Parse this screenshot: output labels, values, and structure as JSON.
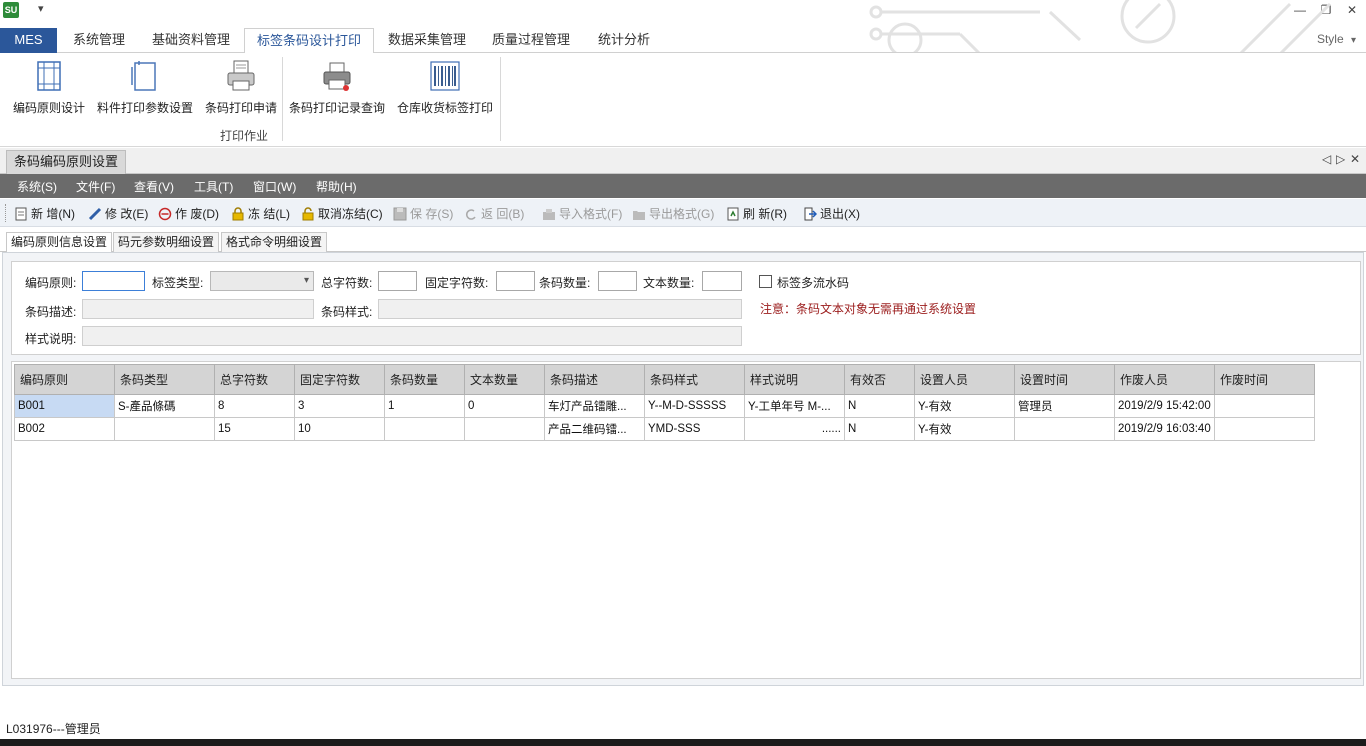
{
  "app": {
    "logo_text": "SU",
    "quick_access": "▾",
    "window_controls": [
      "—",
      "❐",
      "✕"
    ]
  },
  "ribbon": {
    "tabs": [
      {
        "label": "MES"
      },
      {
        "label": "系统管理"
      },
      {
        "label": "基础资料管理"
      },
      {
        "label": "标签条码设计打印"
      },
      {
        "label": "数据采集管理"
      },
      {
        "label": "质量过程管理"
      },
      {
        "label": "统计分析"
      }
    ],
    "active_tab": "标签条码设计打印",
    "style_label": "Style",
    "style_arrow": "▾",
    "buttons": [
      {
        "label": "编码原则设计",
        "icon": "frame-icon"
      },
      {
        "label": "料件打印参数设置",
        "icon": "document-settings-icon"
      },
      {
        "label": "条码打印申请",
        "icon": "printer-document-icon"
      },
      {
        "label": "条码打印记录查询",
        "icon": "printer-icon"
      },
      {
        "label": "仓库收货标签打印",
        "icon": "barcode-icon"
      }
    ],
    "group_label": "打印作业"
  },
  "doc_tab": {
    "label": "条码编码原则设置",
    "controls": [
      "◁",
      "▷",
      "✕"
    ]
  },
  "menu": [
    "系统(S)",
    "文件(F)",
    "查看(V)",
    "工具(T)",
    "窗口(W)",
    "帮助(H)"
  ],
  "toolbar": [
    {
      "label": "新 增(N)",
      "icon": "new-icon",
      "enabled": true
    },
    {
      "label": "修 改(E)",
      "icon": "edit-icon",
      "enabled": true
    },
    {
      "label": "作 废(D)",
      "icon": "void-icon",
      "enabled": true
    },
    {
      "label": "冻 结(L)",
      "icon": "lock-icon",
      "enabled": true
    },
    {
      "label": "取消冻结(C)",
      "icon": "unlock-icon",
      "enabled": true
    },
    {
      "label": "保 存(S)",
      "icon": "save-icon",
      "enabled": false
    },
    {
      "label": "返 回(B)",
      "icon": "undo-icon",
      "enabled": false
    },
    {
      "label": "导入格式(F)",
      "icon": "import-icon",
      "enabled": false
    },
    {
      "label": "导出格式(G)",
      "icon": "export-icon",
      "enabled": false
    },
    {
      "label": "刷 新(R)",
      "icon": "refresh-icon",
      "enabled": true
    },
    {
      "label": "退出(X)",
      "icon": "exit-icon",
      "enabled": true
    }
  ],
  "subtabs": [
    "编码原则信息设置",
    "码元参数明细设置",
    "格式命令明细设置"
  ],
  "form": {
    "rule_label": "编码原则:",
    "label_type_label": "标签类型:",
    "total_chars_label": "总字符数:",
    "fixed_chars_label": "固定字符数:",
    "barcode_count_label": "条码数量:",
    "text_count_label": "文本数量:",
    "multi_serial_label": "标签多流水码",
    "desc_label": "条码描述:",
    "style_label": "条码样式:",
    "style_note_label": "样式说明:",
    "notice": "注意：条码文本对象无需再通过系统设置"
  },
  "grid": {
    "columns": [
      "编码原则",
      "条码类型",
      "总字符数",
      "固定字符数",
      "条码数量",
      "文本数量",
      "条码描述",
      "条码样式",
      "样式说明",
      "有效否",
      "设置人员",
      "设置时间",
      "作废人员",
      "作废时间"
    ],
    "rows": [
      [
        "B001",
        "S-產品條碼",
        "8",
        "3",
        "1",
        "0",
        "车灯产品镭雕...",
        "Y--M-D-SSSSS",
        "Y-工单年号 M-...",
        "N",
        "Y-有效",
        "管理员",
        "2019/2/9 15:42:00",
        ""
      ],
      [
        "B002",
        "",
        "15",
        "10",
        "",
        "",
        "产品二维码镭...",
        "YMD-SSS",
        "......",
        "N",
        "Y-有效",
        "",
        "2019/2/9 16:03:40",
        ""
      ]
    ]
  },
  "status": {
    "text": "L031976---管理员"
  }
}
